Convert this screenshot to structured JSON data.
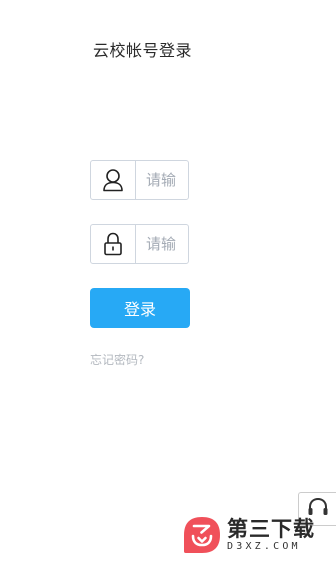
{
  "header": {
    "title": "云校帐号登录"
  },
  "form": {
    "username": {
      "icon": "user-icon",
      "value": "",
      "placeholder": "请输"
    },
    "password": {
      "icon": "lock-icon",
      "value": "",
      "placeholder": "请输"
    },
    "login_label": "登录",
    "forgot_label": "忘记密码?"
  },
  "support": {
    "icon": "headset-icon"
  },
  "watermark": {
    "title": "第三下载",
    "subtitle": "D3XZ.COM"
  },
  "colors": {
    "primary": "#27a9f5",
    "border": "#cfd6df",
    "muted": "#b3b8bf",
    "watermark_red": "#f0505a"
  }
}
